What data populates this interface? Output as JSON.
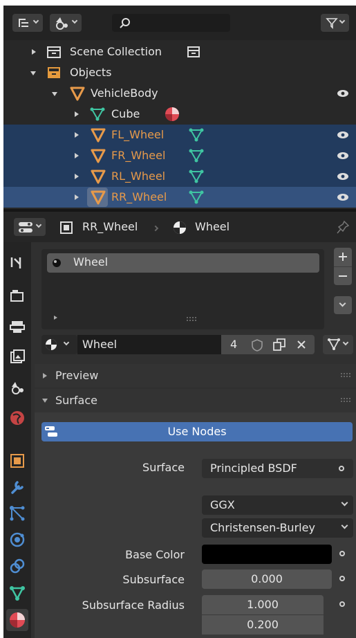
{
  "outliner": {
    "search_placeholder": "",
    "rows": [
      {
        "label": "Scene Collection"
      },
      {
        "label": "Objects"
      },
      {
        "label": "VehicleBody"
      },
      {
        "label": "Cube"
      },
      {
        "label": "FL_Wheel"
      },
      {
        "label": "FR_Wheel"
      },
      {
        "label": "RL_Wheel"
      },
      {
        "label": "RR_Wheel"
      }
    ]
  },
  "properties": {
    "breadcrumb_object": "RR_Wheel",
    "breadcrumb_material": "Wheel",
    "slots": [
      {
        "label": "Wheel"
      }
    ],
    "material_name": "Wheel",
    "user_count": "4",
    "panels": {
      "preview": "Preview",
      "surface": "Surface"
    },
    "use_nodes_label": "Use Nodes",
    "surface_label": "Surface",
    "surface_value": "Principled BSDF",
    "distribution": "GGX",
    "subsurface_method": "Christensen-Burley",
    "base_color_label": "Base Color",
    "base_color": "#000000",
    "subsurface_label": "Subsurface",
    "subsurface_value": "0.000",
    "subsurface_radius_label": "Subsurface Radius",
    "subsurface_radius": [
      "1.000",
      "0.200"
    ]
  }
}
